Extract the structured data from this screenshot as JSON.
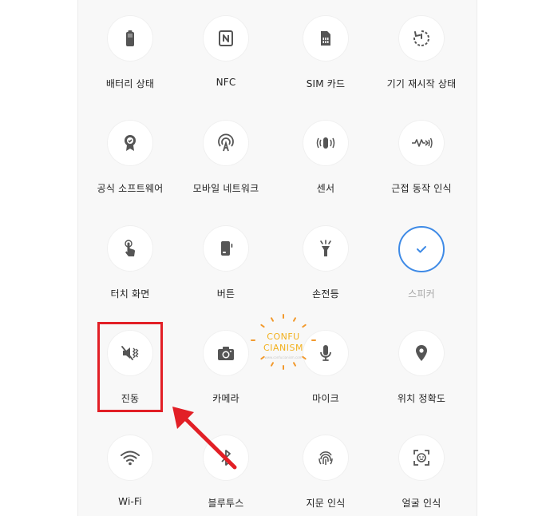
{
  "tiles": [
    {
      "label": "배터리 상태",
      "icon": "battery-icon"
    },
    {
      "label": "NFC",
      "icon": "nfc-icon"
    },
    {
      "label": "SIM 카드",
      "icon": "sim-card-icon"
    },
    {
      "label": "기기 재시작 상태",
      "icon": "restart-timer-icon"
    },
    {
      "label": "공식 소프트웨어",
      "icon": "certified-badge-icon"
    },
    {
      "label": "모바일 네트워크",
      "icon": "antenna-icon"
    },
    {
      "label": "센서",
      "icon": "sensor-vibrate-icon"
    },
    {
      "label": "근접 동작 인식",
      "icon": "proximity-wave-icon"
    },
    {
      "label": "터치 화면",
      "icon": "touch-hand-icon"
    },
    {
      "label": "버튼",
      "icon": "side-button-icon"
    },
    {
      "label": "손전등",
      "icon": "flashlight-icon"
    },
    {
      "label": "스피커",
      "icon": "checkmark-icon"
    },
    {
      "label": "진동",
      "icon": "vibration-off-icon"
    },
    {
      "label": "카메라",
      "icon": "camera-icon"
    },
    {
      "label": "마이크",
      "icon": "microphone-icon"
    },
    {
      "label": "위치 정확도",
      "icon": "location-pin-icon"
    },
    {
      "label": "Wi-Fi",
      "icon": "wifi-icon"
    },
    {
      "label": "블루투스",
      "icon": "bluetooth-icon"
    },
    {
      "label": "지문 인식",
      "icon": "fingerprint-icon"
    },
    {
      "label": "얼굴 인식",
      "icon": "face-scan-icon"
    }
  ],
  "watermark": {
    "line1": "CONFU",
    "line2": "CIANISM",
    "url": "www.confucianism.com"
  },
  "colors": {
    "icon": "#555555",
    "accent": "#3e8ae6",
    "highlight": "#e21f26",
    "panel": "#f8f8f8",
    "watermark": "#f2b01e"
  }
}
